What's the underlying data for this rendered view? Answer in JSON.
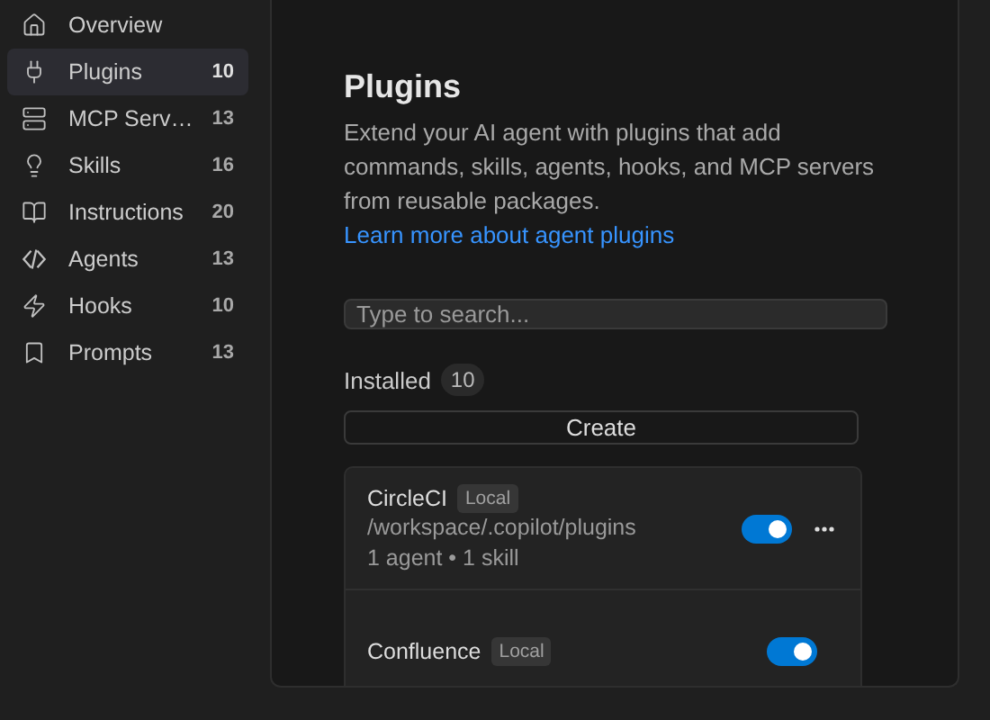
{
  "sidebar": {
    "items": [
      {
        "kind": "overview",
        "label": "Overview",
        "selected": false
      },
      {
        "kind": "plugins",
        "label": "Plugins",
        "count": "10",
        "selected": true
      },
      {
        "kind": "servers",
        "label": "MCP Serv…",
        "count": "13",
        "selected": false
      },
      {
        "kind": "skills",
        "label": "Skills",
        "count": "16",
        "selected": false
      },
      {
        "kind": "instructions",
        "label": "Instructions",
        "count": "20",
        "selected": false
      },
      {
        "kind": "agents",
        "label": "Agents",
        "count": "13",
        "selected": false
      },
      {
        "kind": "hooks",
        "label": "Hooks",
        "count": "10",
        "selected": false
      },
      {
        "kind": "prompts",
        "label": "Prompts",
        "count": "13",
        "selected": false
      }
    ]
  },
  "main": {
    "title": "Plugins",
    "description": "Extend your AI agent with plugins that add commands, skills, agents, hooks, and MCP servers from reusable packages.",
    "link": "Learn more about agent plugins",
    "search": {
      "placeholder": "Type to search..."
    },
    "installed": {
      "label": "Installed",
      "count": "10"
    },
    "create_button": "Create",
    "plugins": [
      {
        "name": "CircleCI",
        "badge": "Local",
        "path": "/workspace/.copilot/plugins",
        "summary": "1 agent • 1 skill",
        "enabled": true
      },
      {
        "name": "Confluence",
        "badge": "Local",
        "enabled": true
      }
    ]
  }
}
